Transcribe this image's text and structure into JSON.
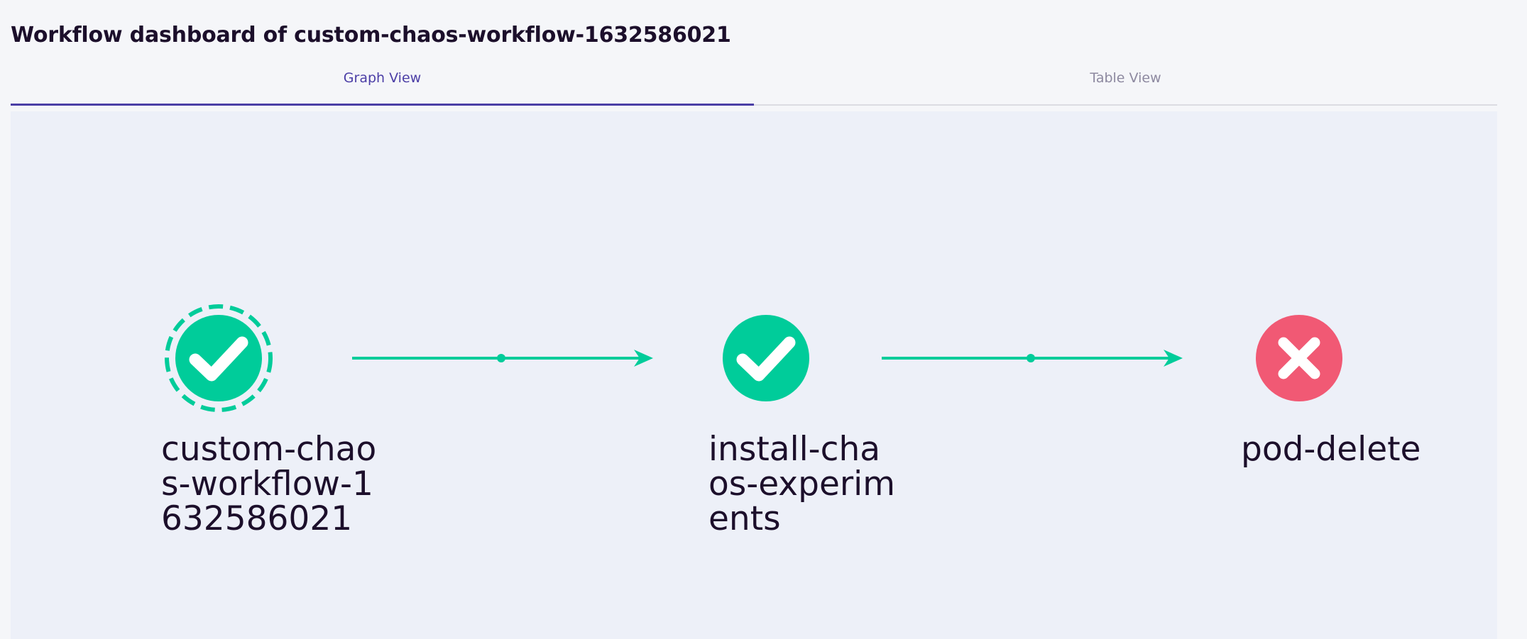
{
  "header": {
    "title": "Workflow dashboard of custom-chaos-workflow-1632586021"
  },
  "tabs": [
    {
      "label": "Graph View",
      "active": true
    },
    {
      "label": "Table View",
      "active": false
    }
  ],
  "colors": {
    "accent": "#4b3ea6",
    "success": "#00cc9a",
    "failure": "#f15974",
    "text_dark": "#1c0f2b"
  },
  "graph": {
    "nodes": [
      {
        "label": "custom-chaos-workflow-1632586021",
        "status": "succeeded",
        "icon": "check-icon"
      },
      {
        "label": "install-chaos-experiments",
        "status": "succeeded",
        "icon": "check-icon"
      },
      {
        "label": "pod-delete",
        "status": "failed",
        "icon": "close-icon"
      }
    ]
  }
}
